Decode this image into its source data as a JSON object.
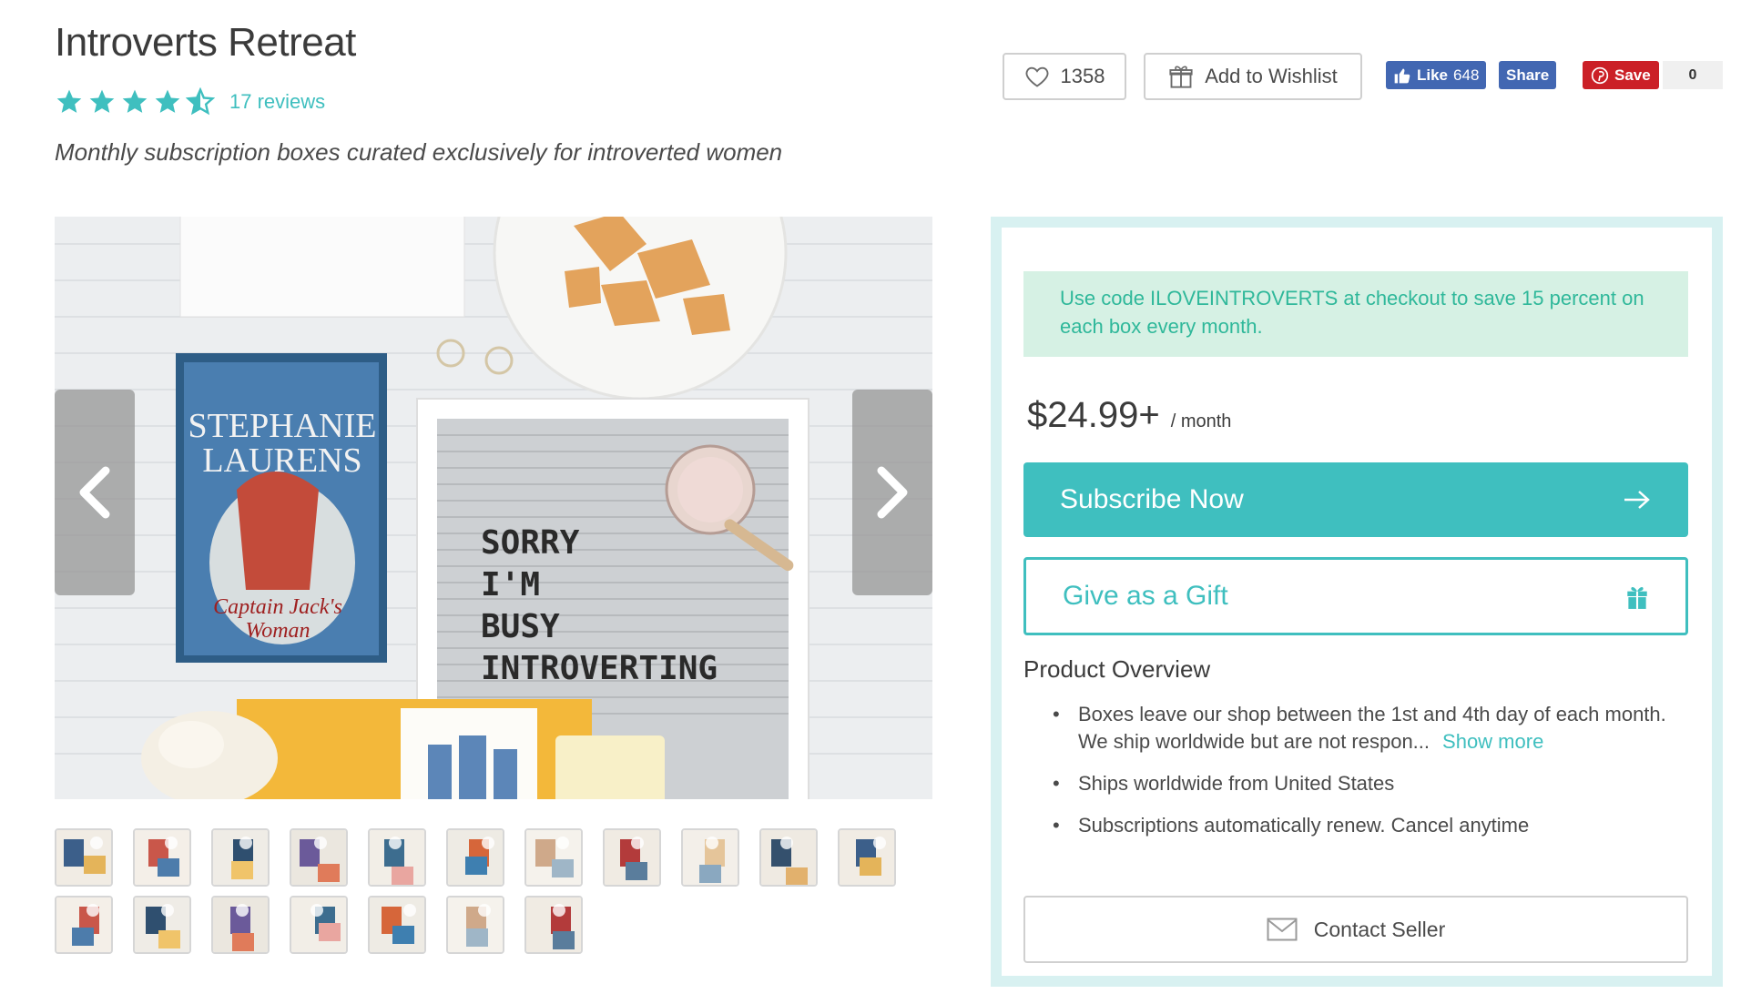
{
  "product": {
    "title": "Introverts Retreat",
    "rating_stars": 4.5,
    "reviews_label": "17 reviews",
    "tagline": "Monthly subscription boxes curated exclusively for introverted women"
  },
  "actions": {
    "like_count": "1358",
    "wishlist_label": "Add to Wishlist",
    "fb_like_label": "Like",
    "fb_like_count": "648",
    "fb_share_label": "Share",
    "pin_save_label": "Save",
    "pin_count": "0"
  },
  "gallery": {
    "letterboard_lines": [
      "SORRY",
      "I'M",
      "BUSY",
      "INTROVERTING"
    ],
    "book_author": [
      "STEPHANIE",
      "LAURENS"
    ],
    "book_title": [
      "Captain Jack's",
      "Woman"
    ],
    "thumbnail_rows": [
      11,
      7
    ]
  },
  "purchase": {
    "promo_text": "Use code ILOVEINTROVERTS at checkout to save 15 percent on each box every month.",
    "price": "$24.99+",
    "price_period": "/ month",
    "subscribe_label": "Subscribe Now",
    "gift_label": "Give as a Gift",
    "overview_title": "Product Overview",
    "overview_items": [
      "Boxes leave our shop between the 1st and 4th day of each month. We ship worldwide but are not respon...",
      "Ships worldwide from United States",
      "Subscriptions automatically renew. Cancel anytime"
    ],
    "show_more_label": "Show more",
    "contact_label": "Contact Seller"
  },
  "colors": {
    "accent": "#3fbfbf",
    "promo_bg": "#d6f1e4",
    "promo_text": "#2fb89a",
    "panel_border": "#d8f1f1",
    "facebook": "#4267b2",
    "pinterest": "#cb2027"
  }
}
